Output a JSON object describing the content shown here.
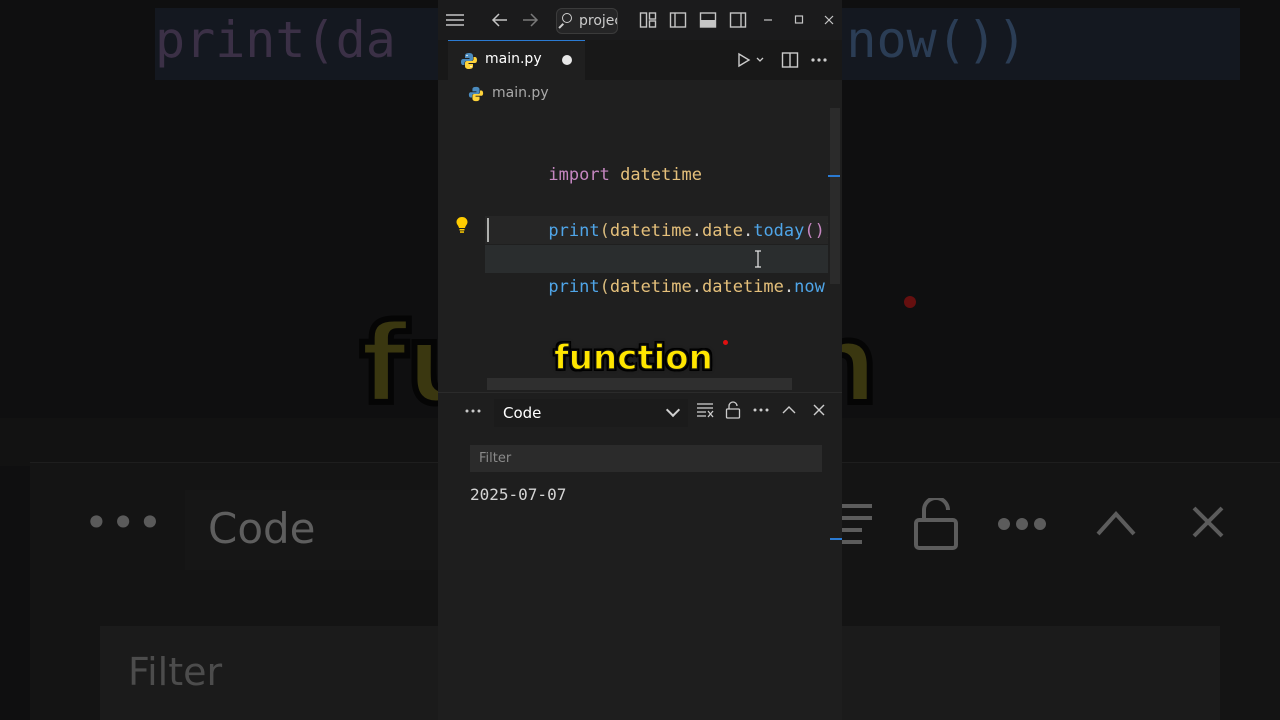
{
  "titlebar": {
    "search_text": "projec",
    "icons": [
      "menu-icon",
      "back-arrow-icon",
      "forward-arrow-icon",
      "search-icon",
      "layout-icon",
      "toggle-primary-sidebar-icon",
      "toggle-panel-icon",
      "toggle-secondary-sidebar-icon",
      "minimize-icon",
      "maximize-icon",
      "close-icon"
    ]
  },
  "tab": {
    "label": "main.py",
    "modified": true
  },
  "breadcrumb": {
    "file": "main.py"
  },
  "editor": {
    "lines": [
      {
        "a": "import",
        "b": " datetime"
      },
      {
        "f": "print",
        "p1": "(",
        "i1": "datetime",
        "d1": ".",
        "i2": "date",
        "d2": ".",
        "f2": "today",
        "p2": "()",
        "p3": ")"
      },
      {
        "f": "print",
        "p1": "(",
        "i1": "datetime",
        "d1": ".",
        "i2": "datetime",
        "d2": ".",
        "f2": "now",
        "p2": "()",
        "p3": ")"
      }
    ]
  },
  "panel": {
    "dropdown_value": "Code",
    "filter_placeholder": "Filter",
    "output": "2025-07-07"
  },
  "caption": "function",
  "background": {
    "code_a": "print(da",
    "code_b": "time.now())",
    "dots": "•••",
    "code_label": "Code",
    "filter": "Filter",
    "fn_a": "fu",
    "fn_b": "n"
  },
  "colors": {
    "accent": "#2b7bd3",
    "caption": "#ffe600",
    "keyword": "#c586c0",
    "function": "#4fa5e8",
    "identifier": "#d7ba7d"
  }
}
